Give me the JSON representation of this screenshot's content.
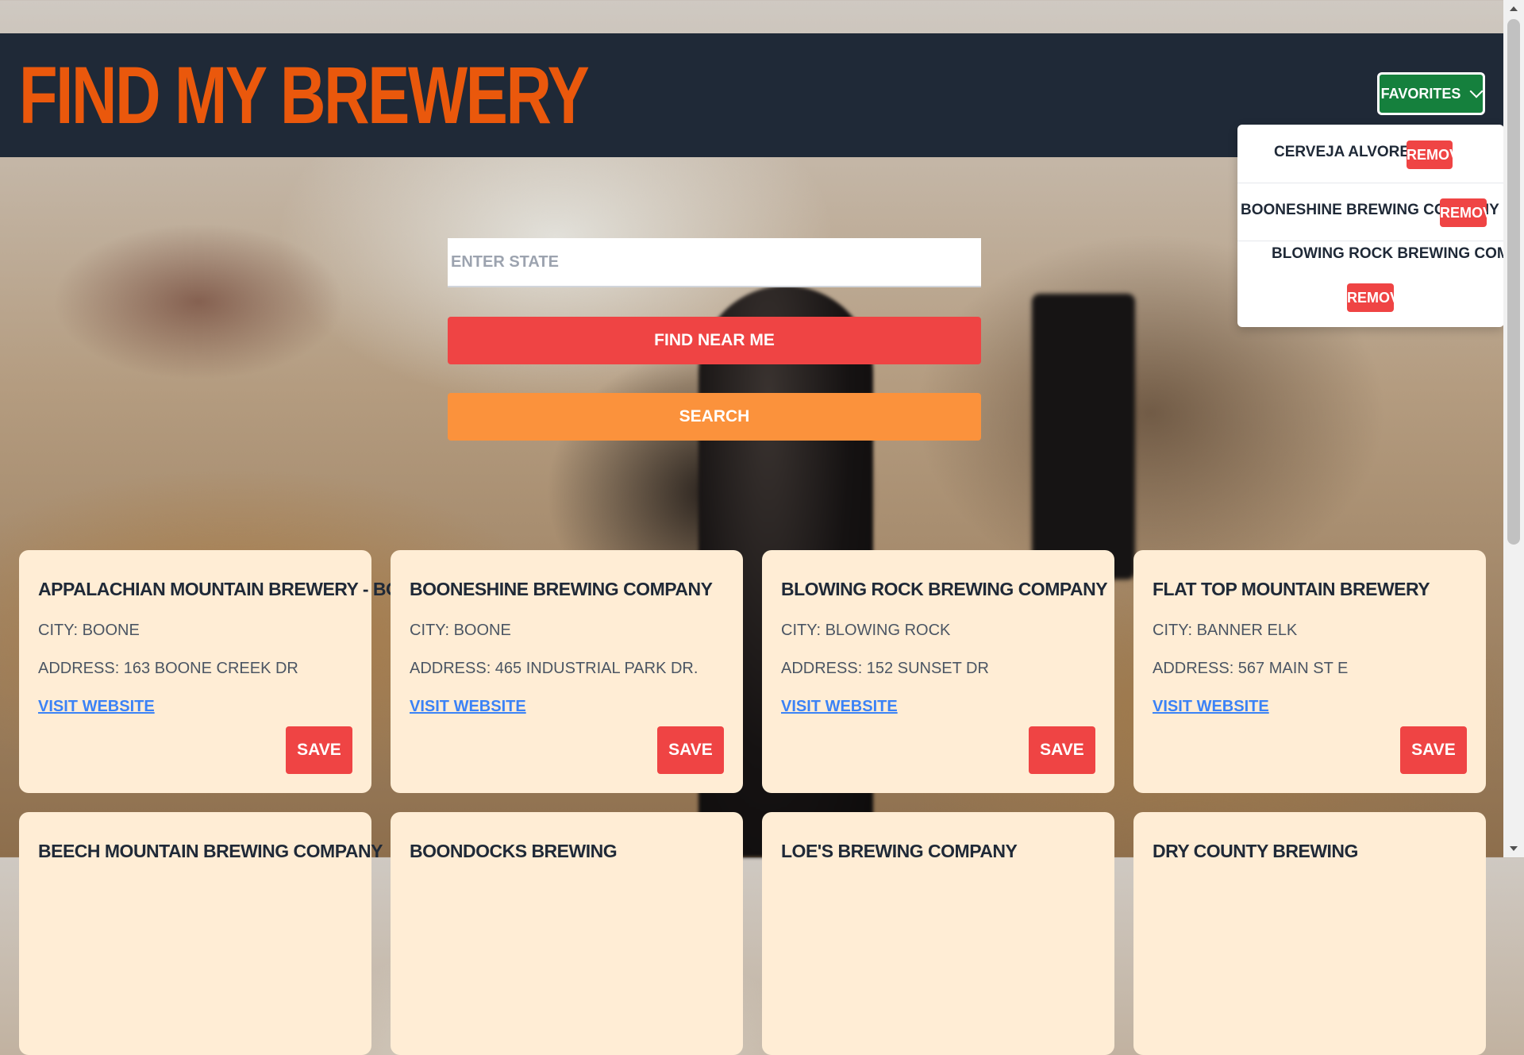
{
  "header": {
    "title": "Find My Brewery",
    "favorites_label": "Favorites"
  },
  "favorites": [
    {
      "name": "Cerveja Alvoreada",
      "remove_label": "Remove"
    },
    {
      "name": "Booneshine Brewing Company",
      "remove_label": "Remove"
    },
    {
      "name": "Blowing Rock Brewing Company",
      "remove_label": "Remove"
    }
  ],
  "search": {
    "placeholder": "ENTER STATE",
    "find_near_me_label": "Find Near Me",
    "search_label": "Search"
  },
  "breweries": [
    {
      "name": "Appalachian Mountain Brewery - Boone",
      "city": "City: Boone",
      "address": "Address: 163 Boone Creek Dr",
      "website_label": "Visit Website",
      "save_label": "Save"
    },
    {
      "name": "Booneshine Brewing Company",
      "city": "City: Boone",
      "address": "Address: 465 Industrial Park Dr.",
      "website_label": "Visit Website",
      "save_label": "Save"
    },
    {
      "name": "Blowing Rock Brewing Company",
      "city": "City: Blowing Rock",
      "address": "Address: 152 Sunset Dr",
      "website_label": "Visit Website",
      "save_label": "Save"
    },
    {
      "name": "Flat Top Mountain Brewery",
      "city": "City: Banner Elk",
      "address": "Address: 567 Main St E",
      "website_label": "Visit Website",
      "save_label": "Save"
    },
    {
      "name": "Beech Mountain Brewing Company"
    },
    {
      "name": "Boondocks Brewing"
    },
    {
      "name": "Loe's Brewing Company"
    },
    {
      "name": "Dry County Brewing"
    }
  ],
  "colors": {
    "header_bg": "#1f2937",
    "title": "#ea580c",
    "favorites_btn": "#15803d",
    "red_button": "#ef4444",
    "orange_button": "#fb923c",
    "card_bg": "#ffedd5",
    "link": "#3b82f6"
  }
}
